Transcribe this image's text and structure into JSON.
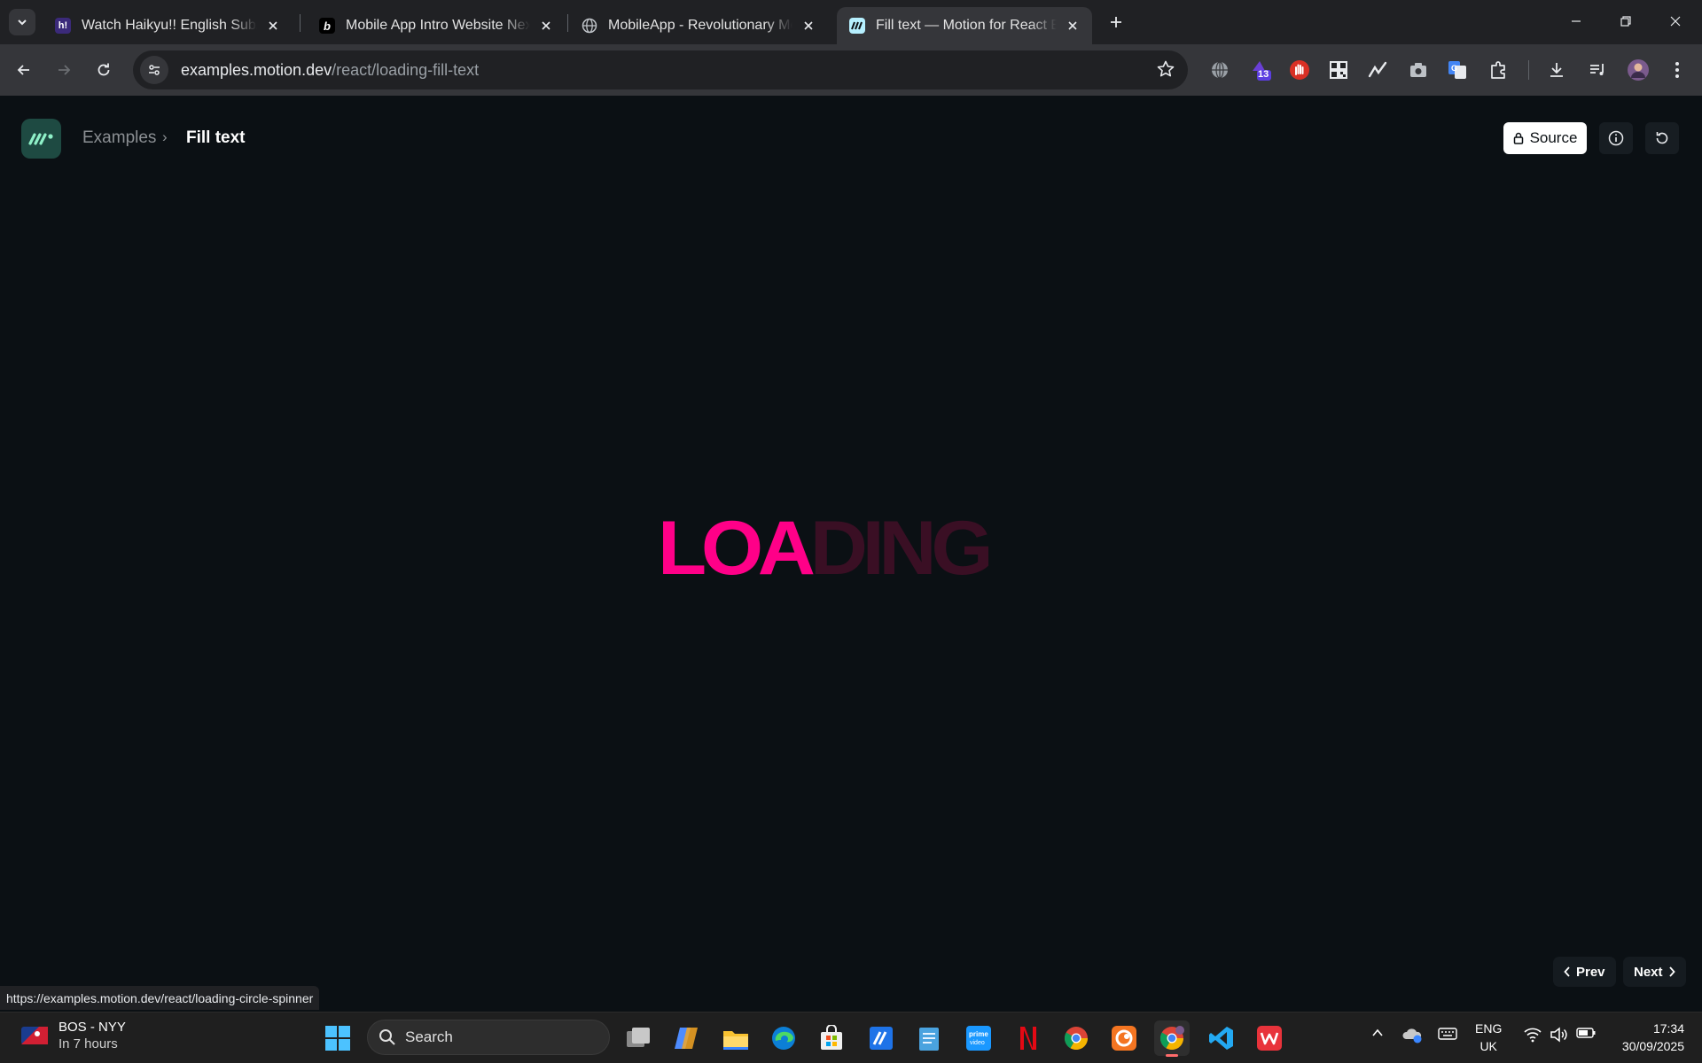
{
  "browser": {
    "tabs": [
      {
        "title": "Watch Haikyu!! English Sub/Dub",
        "favicon": "h!"
      },
      {
        "title": "Mobile App Intro Website Next",
        "favicon": "b"
      },
      {
        "title": "MobileApp - Revolutionary Mobile",
        "favicon": "globe"
      },
      {
        "title": "Fill text — Motion for React Examples",
        "favicon": "motion"
      }
    ],
    "active_tab_index": 3,
    "url_host": "examples.motion.dev",
    "url_path": "/react/loading-fill-text",
    "extension_badge": "13"
  },
  "page": {
    "breadcrumb": {
      "parent": "Examples",
      "separator": "›",
      "current": "Fill text"
    },
    "source_label": "Source",
    "loading_text": {
      "filled": "LOA",
      "unfilled": "DING"
    },
    "prev_label": "Prev",
    "next_label": "Next",
    "colors": {
      "fill": "#ff0088",
      "unfilled": "#3a0f24",
      "background": "#0b1014"
    }
  },
  "status_bar": {
    "hover_url": "https://examples.motion.dev/react/loading-circle-spinner"
  },
  "taskbar": {
    "weather": {
      "line1": "BOS - NYY",
      "line2": "In 7 hours"
    },
    "search_placeholder": "Search",
    "language": {
      "line1": "ENG",
      "line2": "UK"
    },
    "time": "17:34",
    "date": "30/09/2025"
  }
}
